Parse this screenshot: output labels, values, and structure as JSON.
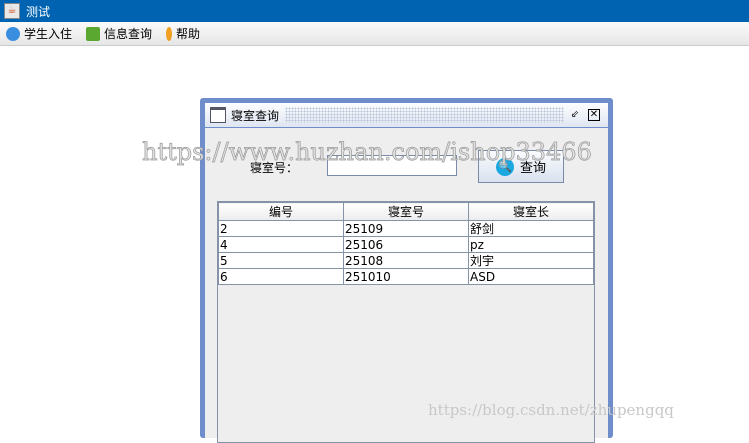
{
  "window": {
    "title": "测试"
  },
  "menubar": [
    {
      "label": "学生入住",
      "icon": "arrow-circle-icon"
    },
    {
      "label": "信息查询",
      "icon": "info-icon"
    },
    {
      "label": "帮助",
      "icon": "key-icon"
    }
  ],
  "internal_frame": {
    "title": "寝室查询"
  },
  "form": {
    "label": "寝室号：",
    "input_value": "",
    "button_label": "查询"
  },
  "table": {
    "headers": [
      "编号",
      "寝室号",
      "寝室长"
    ],
    "rows": [
      [
        "2",
        "25109",
        "舒剑"
      ],
      [
        "4",
        "25106",
        "pz"
      ],
      [
        "5",
        "25108",
        "刘宇"
      ],
      [
        "6",
        "251010",
        "ASD"
      ]
    ]
  },
  "watermarks": [
    "https://www.huzhan.com/ishop33466",
    "https://blog.csdn.net/zhupengqq"
  ],
  "colors": {
    "titlebar": "#0063b1",
    "frame_border": "#6f8ccb"
  }
}
